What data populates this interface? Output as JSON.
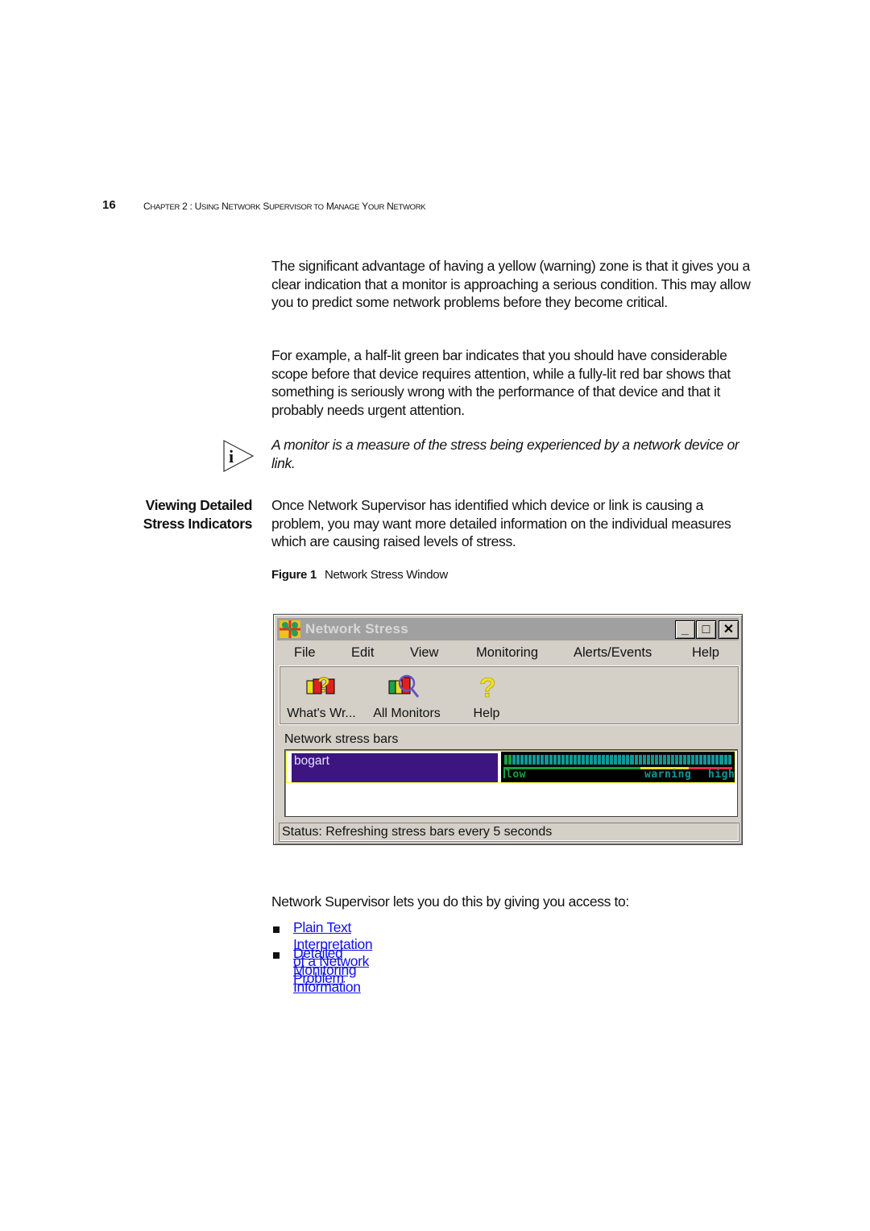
{
  "header": {
    "page_number": "16",
    "running_head_parts": [
      {
        "text": "C",
        "sc": false
      },
      {
        "text": "HAPTER",
        "sc": true
      },
      {
        "text": " 2 : U",
        "sc": false
      },
      {
        "text": "SING",
        "sc": true
      },
      {
        "text": " N",
        "sc": false
      },
      {
        "text": "ETWORK",
        "sc": true
      },
      {
        "text": " S",
        "sc": false
      },
      {
        "text": "UPERVISOR TO",
        "sc": true
      },
      {
        "text": " M",
        "sc": false
      },
      {
        "text": "ANAGE",
        "sc": true
      },
      {
        "text": " Y",
        "sc": false
      },
      {
        "text": "OUR",
        "sc": true
      },
      {
        "text": " N",
        "sc": false
      },
      {
        "text": "ETWORK",
        "sc": true
      }
    ]
  },
  "body": {
    "para1": "The significant advantage of having a yellow (warning) zone is that it gives you a clear indication that a monitor is approaching a serious condition. This may allow you to predict some network problems before they become critical.",
    "para2": "For example, a half-lit green bar indicates that you should have considerable scope before that device requires attention, while a fully-lit red bar shows that something is seriously wrong with the performance of that device and that it probably needs urgent attention.",
    "note": "A monitor is a measure of the stress being experienced by a network device or link.",
    "section_heading_line1": "Viewing Detailed",
    "section_heading_line2": "Stress Indicators",
    "para3": "Once Network Supervisor has identified which device or link is causing a problem, you may want more detailed information on the individual measures which are causing raised levels of stress.",
    "figure_label": "Figure 1",
    "figure_title": "Network Stress Window",
    "para4": "Network Supervisor lets you do this by giving you access to:",
    "links": [
      "Plain Text Interpretation of a Network Problem",
      "Detailed Monitoring Information"
    ],
    "link_color": "#1010ee"
  },
  "window": {
    "title": "Network Stress",
    "controls": {
      "minimize": "_",
      "maximize": "□",
      "close": "✕"
    },
    "menu": [
      "File",
      "Edit",
      "View",
      "Monitoring",
      "Alerts/Events",
      "Help"
    ],
    "toolbar": [
      {
        "label": "What's Wr...",
        "icon": "whats-wrong-icon"
      },
      {
        "label": "All Monitors",
        "icon": "all-monitors-icon"
      },
      {
        "label": "Help",
        "icon": "help-icon"
      }
    ],
    "stress_bars_label": "Network stress bars",
    "stress_rows": [
      {
        "device": "bogart",
        "lit_segments": 2,
        "total_segments": 56,
        "level": "low"
      }
    ],
    "zones": {
      "low_label": "low",
      "warning_label": "warning",
      "high_label": "high",
      "low_end_fraction": 0.6,
      "warning_end_fraction": 0.81,
      "low_color": "#18a040",
      "warning_color": "#f0e020",
      "high_color": "#e03040",
      "unlit_color": "#109898"
    },
    "status": "Status: Refreshing stress bars every 5 seconds"
  }
}
